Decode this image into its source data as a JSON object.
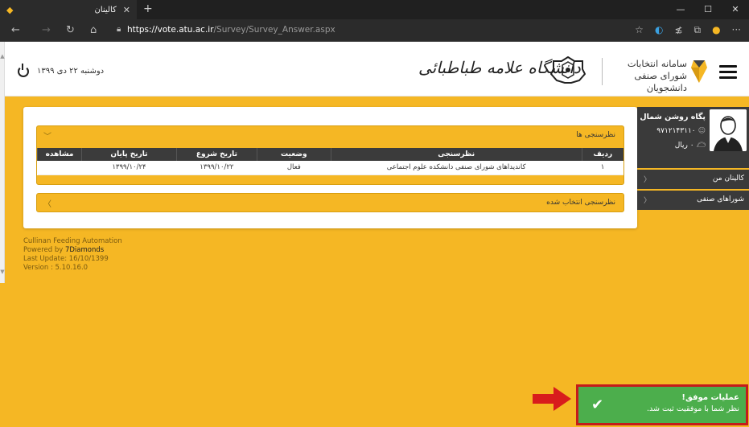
{
  "browser": {
    "tab_title": "کالینان",
    "url_host": "https://vote.atu.ac.ir",
    "url_path": "/Survey/Survey_Answer.aspx",
    "icons": [
      "back-icon",
      "forward-icon",
      "refresh-icon",
      "home-icon",
      "lock-icon",
      "star-icon",
      "favorites-icon",
      "collections-icon",
      "extension-icon",
      "more-icon"
    ]
  },
  "header": {
    "date": "دوشنبه ۲۲ دی ۱۳۹۹",
    "university": "دانشگاه علامه طباطبائی",
    "system_title_line1": "سامانه انتخابات",
    "system_title_line2": "شورای صنفی دانشجویان"
  },
  "profile": {
    "name": "پگاه روشن شمال",
    "code": "۹۷۱۲۱۴۳۱۱۰",
    "balance": "۰ ریال"
  },
  "sidebar": {
    "items": [
      {
        "label": "کالینان من"
      },
      {
        "label": "شوراهای صنفی"
      }
    ]
  },
  "surveys": {
    "title": "نظرسنجی ها",
    "columns": {
      "row": "ردیف",
      "survey": "نظرسنجی",
      "status": "وضعیت",
      "start": "تاریخ شروع",
      "end": "تاریخ پایان",
      "view": "مشاهده"
    },
    "rows": [
      {
        "row": "۱",
        "survey": "کاندیداهای شورای صنفی دانشکده علوم اجتماعی",
        "status": "فعال",
        "start": "۱۳۹۹/۱۰/۲۲",
        "end": "۱۳۹۹/۱۰/۲۴",
        "view": ""
      }
    ]
  },
  "selected_section": {
    "title": "نظرسنجی انتخاب شده"
  },
  "footer": {
    "line1": "Cullinan Feeding Automation",
    "line2_prefix": "Powered by ",
    "line2_brand": "7Diamonds",
    "line3": "Last Update: 16/10/1399",
    "line4": "Version : 5.10.16.0"
  },
  "toast": {
    "title": "عملیات موفق!",
    "message": "نظر شما با موفقیت ثبت شد.",
    "color": "#4cae4c"
  },
  "colors": {
    "brand_yellow": "#f5b724",
    "dark": "#3a3a3a",
    "highlight_red": "#c41b1b"
  }
}
